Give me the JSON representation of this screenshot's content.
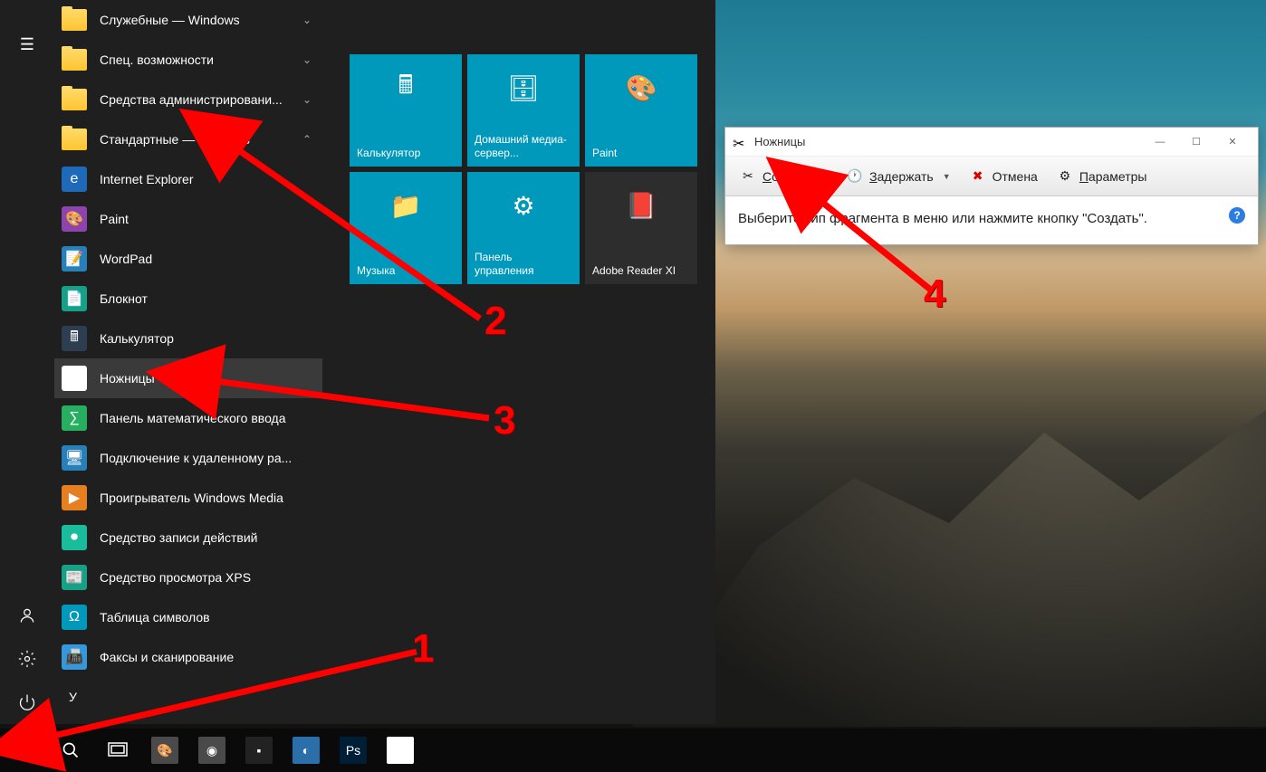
{
  "start_menu": {
    "folders": [
      {
        "label": "Служебные — Windows",
        "expand": "⌄"
      },
      {
        "label": "Спец. возможности",
        "expand": "⌄"
      },
      {
        "label": "Средства администрировани...",
        "expand": "⌄"
      },
      {
        "label": "Стандартные — Windows",
        "expand": "⌃"
      }
    ],
    "apps": [
      {
        "label": "Internet Explorer",
        "icon_bg": "#1e6ab8",
        "icon_char": "e"
      },
      {
        "label": "Paint",
        "icon_bg": "#8e44ad",
        "icon_char": "🎨"
      },
      {
        "label": "WordPad",
        "icon_bg": "#2980b9",
        "icon_char": "📝"
      },
      {
        "label": "Блокнот",
        "icon_bg": "#16a085",
        "icon_char": "📄"
      },
      {
        "label": "Калькулятор",
        "icon_bg": "#2c3e50",
        "icon_char": "🖩"
      },
      {
        "label": "Ножницы",
        "icon_bg": "#fff",
        "icon_char": "✂",
        "highlighted": true
      },
      {
        "label": "Панель математического ввода",
        "icon_bg": "#27ae60",
        "icon_char": "∑"
      },
      {
        "label": "Подключение к удаленному ра...",
        "icon_bg": "#2980b9",
        "icon_char": "🖥"
      },
      {
        "label": "Проигрыватель Windows Media",
        "icon_bg": "#e67e22",
        "icon_char": "▶"
      },
      {
        "label": "Средство записи действий",
        "icon_bg": "#1abc9c",
        "icon_char": "⏺"
      },
      {
        "label": "Средство просмотра XPS",
        "icon_bg": "#16a085",
        "icon_char": "📰"
      },
      {
        "label": "Таблица символов",
        "icon_bg": "#0099bc",
        "icon_char": "Ω"
      },
      {
        "label": "Факсы и сканирование",
        "icon_bg": "#3498db",
        "icon_char": "📠"
      }
    ],
    "letter": "У",
    "tiles": [
      {
        "label": "Калькулятор",
        "icon": "🖩",
        "color": "teal"
      },
      {
        "label": "Домашний медиа-сервер...",
        "icon": "🗄",
        "color": "teal"
      },
      {
        "label": "Paint",
        "icon": "🎨",
        "color": "teal"
      },
      {
        "label": "Музыка",
        "icon": "📁",
        "color": "teal"
      },
      {
        "label": "Панель управления",
        "icon": "⚙",
        "color": "teal"
      },
      {
        "label": "Adobe Reader XI",
        "icon": "📕",
        "color": "dark"
      }
    ]
  },
  "snip": {
    "title": "Ножницы",
    "toolbar": {
      "create": "Создать",
      "delay": "Задержать",
      "cancel": "Отмена",
      "settings": "Параметры"
    },
    "body": "Выберите тип фрагмента в меню или нажмите кнопку \"Создать\"."
  },
  "taskbar_apps": [
    {
      "name": "paint",
      "icon": "🎨",
      "bg": "#4a4a4a"
    },
    {
      "name": "chrome",
      "icon": "◉",
      "bg": "#4a4a4a"
    },
    {
      "name": "cmd",
      "icon": "▪",
      "bg": "#222"
    },
    {
      "name": "disc",
      "icon": "◐",
      "bg": "#2a6eaa"
    },
    {
      "name": "photoshop",
      "icon": "Ps",
      "bg": "#001e36"
    },
    {
      "name": "snip",
      "icon": "✂",
      "bg": "#fff"
    }
  ],
  "annotations": {
    "n1": "1",
    "n2": "2",
    "n3": "3",
    "n4": "4"
  }
}
